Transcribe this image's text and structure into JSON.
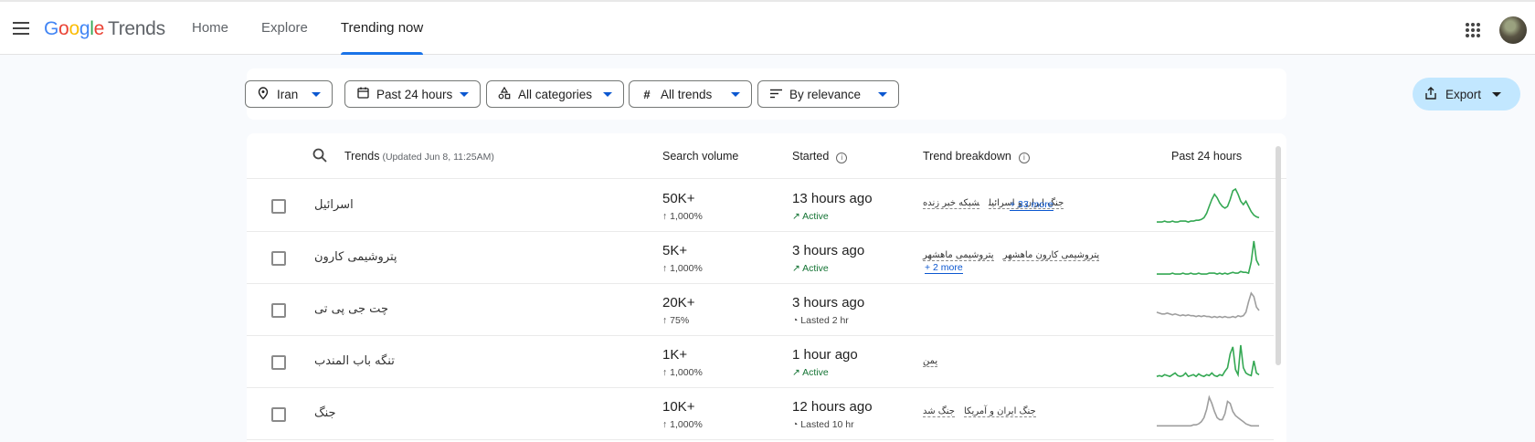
{
  "header": {
    "logo": {
      "g": "G",
      "o1": "o",
      "o2": "o",
      "g2": "g",
      "l": "l",
      "e": "e",
      "trends": "Trends"
    },
    "nav": [
      {
        "label": "Home"
      },
      {
        "label": "Explore"
      },
      {
        "label": "Trending now"
      }
    ],
    "active_nav": "Trending now"
  },
  "filters": {
    "location": "Iran",
    "time": "Past 24 hours",
    "category": "All categories",
    "trends": "All trends",
    "sort": "By relevance",
    "export": "Export"
  },
  "table": {
    "headers": {
      "trends": "Trends",
      "updated": "(Updated Jun 8, 11:25AM)",
      "search_volume": "Search volume",
      "started": "Started",
      "trend_breakdown": "Trend breakdown",
      "past": "Past 24 hours"
    },
    "rows": [
      {
        "term": "اسرائیل",
        "volume": "50K+",
        "pct": "↑ 1,000%",
        "started": "13 hours ago",
        "status": "Active",
        "status_type": "active",
        "breakdown": [
          "جنگ ایران و اسرائیل",
          "شبکه خبر زنده"
        ],
        "more": "+ 33 more",
        "spark_color": "#34a853",
        "spark": [
          2,
          2,
          2,
          3,
          2,
          2,
          3,
          2,
          2,
          3,
          3,
          3,
          2,
          3,
          3,
          4,
          4,
          5,
          7,
          12,
          20,
          28,
          34,
          30,
          24,
          20,
          18,
          20,
          28,
          38,
          40,
          34,
          26,
          22,
          26,
          20,
          14,
          10,
          8,
          7
        ]
      },
      {
        "term": "پتروشیمی کارون",
        "volume": "5K+",
        "pct": "↑ 1,000%",
        "started": "3 hours ago",
        "status": "Active",
        "status_type": "active",
        "breakdown": [
          "پتروشیمی کارون ماهشهر",
          "پتروشیمی ماهشهر"
        ],
        "more": "+ 2 more",
        "spark_color": "#34a853",
        "spark": [
          2,
          2,
          2,
          2,
          2,
          2,
          3,
          2,
          2,
          2,
          3,
          2,
          2,
          3,
          2,
          2,
          3,
          2,
          2,
          2,
          3,
          3,
          3,
          2,
          3,
          2,
          3,
          2,
          3,
          4,
          3,
          3,
          5,
          4,
          4,
          3,
          16,
          40,
          18,
          12
        ]
      },
      {
        "term": "چت جی پی تی",
        "volume": "20K+",
        "pct": "↑ 75%",
        "started": "3 hours ago",
        "status": "Lasted 2 hr",
        "status_type": "lasted",
        "breakdown": [],
        "more": "",
        "spark_color": "#9e9e9e",
        "spark": [
          18,
          17,
          16,
          16,
          17,
          16,
          15,
          16,
          15,
          14,
          15,
          14,
          15,
          14,
          14,
          13,
          14,
          13,
          14,
          13,
          13,
          12,
          13,
          12,
          13,
          12,
          13,
          12,
          12,
          13,
          12,
          14,
          13,
          14,
          18,
          30,
          40,
          36,
          24,
          20
        ]
      },
      {
        "term": "تنگه باب المندب",
        "volume": "1K+",
        "pct": "↑ 1,000%",
        "started": "1 hour ago",
        "status": "Active",
        "status_type": "active",
        "breakdown": [
          "یمن"
        ],
        "more": "",
        "spark_color": "#34a853",
        "spark": [
          4,
          5,
          4,
          6,
          5,
          4,
          6,
          8,
          5,
          4,
          5,
          8,
          4,
          5,
          6,
          4,
          7,
          5,
          4,
          6,
          5,
          8,
          5,
          4,
          6,
          5,
          10,
          14,
          30,
          38,
          12,
          6,
          40,
          14,
          8,
          6,
          5,
          22,
          8,
          6
        ]
      },
      {
        "term": "جنگ",
        "volume": "10K+",
        "pct": "↑ 1,000%",
        "started": "12 hours ago",
        "status": "Lasted 10 hr",
        "status_type": "lasted",
        "breakdown": [
          "جنگ ایران و آمریکا",
          "جنگ شد"
        ],
        "more": "",
        "spark_color": "#9e9e9e",
        "spark": [
          6,
          6,
          6,
          6,
          6,
          6,
          6,
          6,
          6,
          6,
          6,
          6,
          6,
          6,
          7,
          7,
          8,
          10,
          14,
          22,
          34,
          28,
          20,
          14,
          12,
          12,
          18,
          30,
          28,
          20,
          16,
          14,
          12,
          10,
          8,
          7,
          6,
          6,
          6,
          6
        ]
      }
    ]
  }
}
